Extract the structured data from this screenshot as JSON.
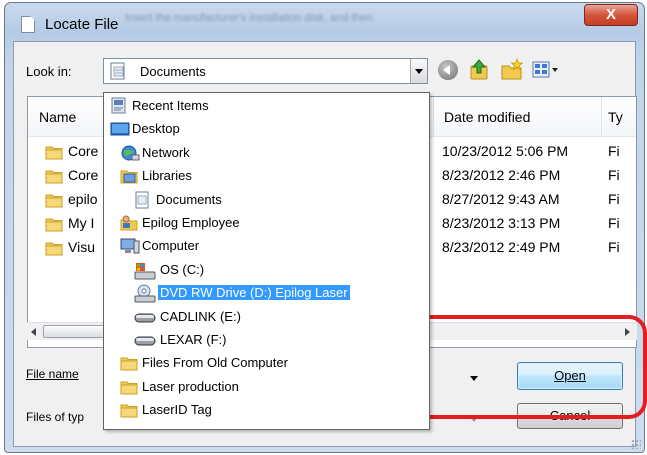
{
  "window": {
    "title": "Locate File",
    "close_label": "X",
    "title_ghost": "Insert the manufacturer's installation disk, and then"
  },
  "toolbar": {
    "look_in_label": "Look in:",
    "look_in_value": "Documents",
    "back_icon": "back-arrow-icon",
    "up_icon": "up-folder-icon",
    "new_folder_icon": "new-folder-icon",
    "views_icon": "views-menu-icon"
  },
  "file_list": {
    "columns": [
      "Name",
      "Date modified",
      "Ty"
    ],
    "rows": [
      {
        "name": "Core",
        "date": "10/23/2012 5:06 PM",
        "type": "Fi"
      },
      {
        "name": "Core",
        "date": "8/23/2012 2:46 PM",
        "type": "Fi"
      },
      {
        "name": "epilo",
        "date": "8/27/2012 9:43 AM",
        "type": "Fi"
      },
      {
        "name": "My I",
        "date": "8/23/2012 3:13 PM",
        "type": "Fi"
      },
      {
        "name": "Visu",
        "date": "8/23/2012 2:49 PM",
        "type": "Fi"
      }
    ]
  },
  "dropdown": {
    "items": [
      {
        "label": "Recent Items",
        "icon": "recent-items-icon",
        "indent": 0,
        "selected": false
      },
      {
        "label": "Desktop",
        "icon": "desktop-icon",
        "indent": 0,
        "selected": false
      },
      {
        "label": "Network",
        "icon": "network-icon",
        "indent": 1,
        "selected": false
      },
      {
        "label": "Libraries",
        "icon": "libraries-icon",
        "indent": 1,
        "selected": false
      },
      {
        "label": "Documents",
        "icon": "documents-icon",
        "indent": 2,
        "selected": false
      },
      {
        "label": "Epilog Employee",
        "icon": "user-folder-icon",
        "indent": 1,
        "selected": false
      },
      {
        "label": "Computer",
        "icon": "computer-icon",
        "indent": 1,
        "selected": false
      },
      {
        "label": "OS (C:)",
        "icon": "hard-drive-icon",
        "indent": 2,
        "selected": false
      },
      {
        "label": "DVD RW Drive (D:) Epilog Laser",
        "icon": "dvd-drive-icon",
        "indent": 2,
        "selected": true
      },
      {
        "label": "CADLINK (E:)",
        "icon": "removable-drive-icon",
        "indent": 2,
        "selected": false
      },
      {
        "label": "LEXAR (F:)",
        "icon": "removable-drive-icon",
        "indent": 2,
        "selected": false
      },
      {
        "label": "Files From Old Computer",
        "icon": "folder-icon",
        "indent": 1,
        "selected": false
      },
      {
        "label": "Laser production",
        "icon": "folder-icon",
        "indent": 1,
        "selected": false
      },
      {
        "label": "LaserID Tag",
        "icon": "folder-icon",
        "indent": 1,
        "selected": false
      }
    ]
  },
  "bottom": {
    "file_name_label": "File name",
    "file_name_underline": "n",
    "files_of_type_label": "Files of typ",
    "open_label": "Open",
    "cancel_label": "Cancel"
  },
  "colors": {
    "highlight": "#e41e1e",
    "selection": "#3399ff",
    "close_button": "#c63d24"
  }
}
